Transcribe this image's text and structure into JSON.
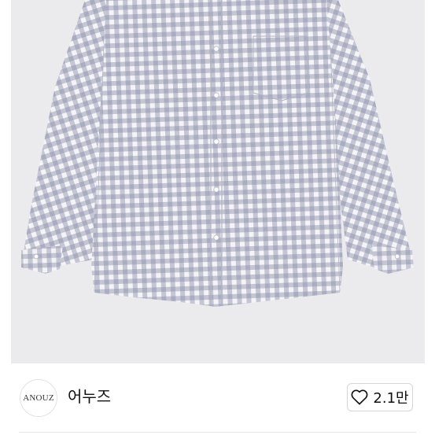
{
  "product": {
    "image_name": "gray-gingham-check-shirt",
    "image_background_color": "#ebebee",
    "check_color": "#8a8ea6"
  },
  "brand": {
    "logo_text": "ANOUZ",
    "name": "어누즈"
  },
  "like": {
    "icon": "heart-outline-icon",
    "count": "2.1만"
  }
}
